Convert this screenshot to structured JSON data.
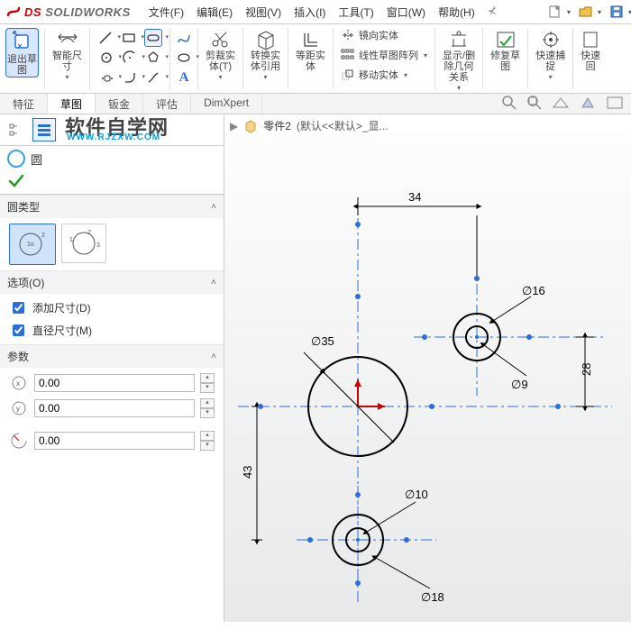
{
  "app": {
    "brand_ds": "DS",
    "brand_name": "SOLIDWORKS"
  },
  "menu": {
    "file": "文件(F)",
    "edit": "编辑(E)",
    "view": "视图(V)",
    "insert": "插入(I)",
    "tools": "工具(T)",
    "window": "窗口(W)",
    "help": "帮助(H)"
  },
  "ribbon": {
    "exit_sketch": "退出草\n图",
    "smart_dim": "智能尺\n寸",
    "trim": "剪裁实\n体(T)",
    "convert": "转换实\n体引用",
    "offset": "等距实\n体",
    "mirror": "镜向实体",
    "linear_pattern": "线性草图阵列",
    "move": "移动实体",
    "show_rel": "显示/删\n除几何\n关系",
    "repair": "修复草\n图",
    "quick": "快速捕\n捉",
    "quickret": "快速\n回"
  },
  "tabs": {
    "feature": "特征",
    "sketch": "草图",
    "sheetmetal": "钣金",
    "evaluate": "评估",
    "dimxpert": "DimXpert"
  },
  "watermark": {
    "cn": "软件自学网",
    "en": "WWW.RJZXW.COM"
  },
  "tool": {
    "name": "圆"
  },
  "sections": {
    "circle_type": "圆类型",
    "options": "选项(O)",
    "params": "参数"
  },
  "options": {
    "add_dim": "添加尺寸(D)",
    "dia_dim": "直径尺寸(M)"
  },
  "params": {
    "cx": "0.00",
    "cy": "0.00",
    "r": "0.00"
  },
  "crumb": {
    "part": "零件2",
    "state": "(默认<<默认>_显..."
  },
  "dims": {
    "d35": "∅35",
    "d16": "∅16",
    "d9": "∅9",
    "d10": "∅10",
    "d18": "∅18",
    "h34": "34",
    "v28": "28",
    "v43": "43"
  }
}
